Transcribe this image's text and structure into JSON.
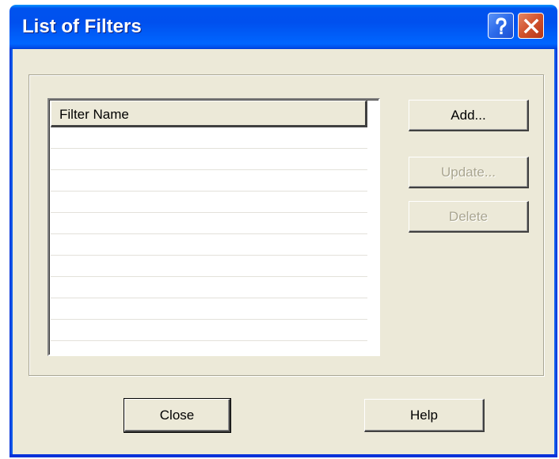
{
  "window": {
    "title": "List of Filters",
    "help_icon": "question-mark-icon",
    "close_icon": "close-x-icon",
    "accent_color": "#0053EE",
    "close_color": "#D1522D"
  },
  "list": {
    "column_header": "Filter Name",
    "rows": [
      "",
      "",
      "",
      "",
      "",
      "",
      "",
      "",
      "",
      "",
      ""
    ]
  },
  "side_buttons": {
    "add_label": "Add...",
    "update_label": "Update...",
    "delete_label": "Delete"
  },
  "footer": {
    "close_label": "Close",
    "help_label": "Help"
  }
}
